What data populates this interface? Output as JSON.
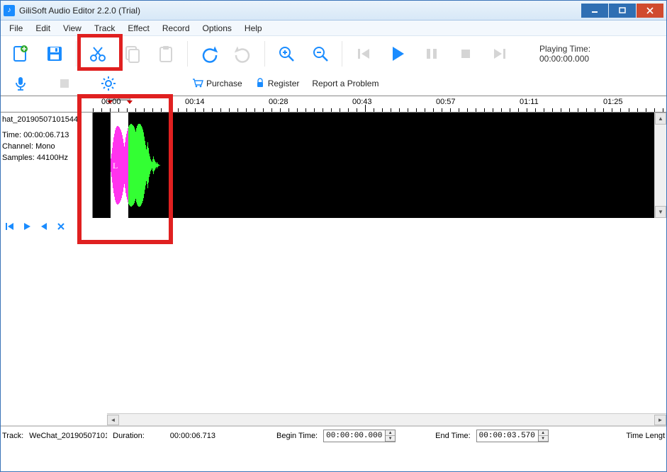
{
  "window": {
    "title": "GiliSoft Audio Editor 2.2.0 (Trial)"
  },
  "menu": {
    "file": "File",
    "edit": "Edit",
    "view": "View",
    "track": "Track",
    "effect": "Effect",
    "record": "Record",
    "options": "Options",
    "help": "Help"
  },
  "playing": {
    "label": "Playing Time:",
    "value": "00:00:00.000"
  },
  "links": {
    "purchase": "Purchase",
    "register": "Register",
    "report": "Report a Problem"
  },
  "ruler": {
    "t1": "00:00",
    "t2": "00:14",
    "t3": "00:28",
    "t4": "00:43",
    "t5": "00:57",
    "t6": "01:11",
    "t7": "01:25"
  },
  "trackinfo": {
    "name": "hat_20190507101544",
    "time_lbl": "Time: ",
    "time_val": "00:00:06.713",
    "channel_lbl": "Channel: ",
    "channel_val": "Mono",
    "samples_lbl": "Samples: ",
    "samples_val": "44100Hz",
    "L": "L"
  },
  "status": {
    "track_lbl": "Track:",
    "track_val": "WeChat_20190507101",
    "dur_lbl": "Duration:",
    "dur_val": "00:00:06.713",
    "begin_lbl": "Begin Time:",
    "begin_val": "00:00:00.000",
    "end_lbl": "End Time:",
    "end_val": "00:00:03.570",
    "tl_lbl": "Time Lengt"
  }
}
